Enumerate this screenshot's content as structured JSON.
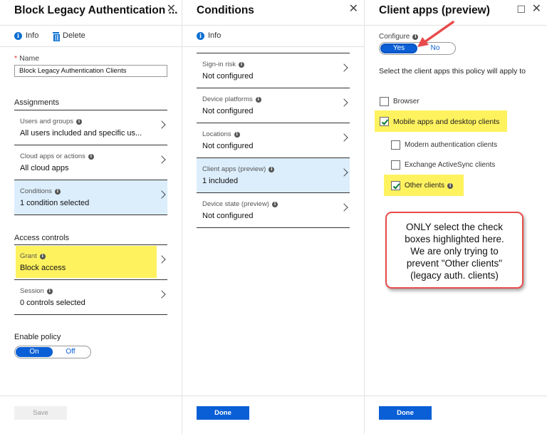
{
  "policy_blade": {
    "title": "Block Legacy Authentication ...",
    "close_icon": "close-icon",
    "toolbar": [
      {
        "label": "Info",
        "icon": "info-icon"
      },
      {
        "label": "Delete",
        "icon": "trash-icon"
      }
    ],
    "name_label": "Name",
    "name_required": "*",
    "name_value": "Block Legacy Authentication Clients",
    "assignments_title": "Assignments",
    "assignments": [
      {
        "label": "Users and groups",
        "value": "All users included and specific us..."
      },
      {
        "label": "Cloud apps or actions",
        "value": "All cloud apps"
      },
      {
        "label": "Conditions",
        "value": "1 condition selected",
        "selected": true
      }
    ],
    "access_controls_title": "Access controls",
    "access_controls": [
      {
        "label": "Grant",
        "value": "Block access",
        "highlighted": true
      },
      {
        "label": "Session",
        "value": "0 controls selected"
      }
    ],
    "enable_policy_label": "Enable policy",
    "enable_toggle": {
      "on": "On",
      "off": "Off",
      "selected": "On"
    },
    "save_label": "Save"
  },
  "conditions_blade": {
    "title": "Conditions",
    "toolbar": [
      {
        "label": "Info",
        "icon": "info-icon"
      }
    ],
    "items": [
      {
        "label": "Sign-in risk",
        "value": "Not configured"
      },
      {
        "label": "Device platforms",
        "value": "Not configured"
      },
      {
        "label": "Locations",
        "value": "Not configured"
      },
      {
        "label": "Client apps (preview)",
        "value": "1 included",
        "selected": true
      },
      {
        "label": "Device state (preview)",
        "value": "Not configured"
      }
    ],
    "done_label": "Done"
  },
  "client_apps_blade": {
    "title": "Client apps (preview)",
    "configure_label": "Configure",
    "configure_toggle": {
      "on": "Yes",
      "off": "No",
      "selected": "Yes"
    },
    "description": "Select the client apps this policy will apply to",
    "checkboxes": [
      {
        "label": "Browser",
        "checked": false
      },
      {
        "label": "Mobile apps and desktop clients",
        "checked": true,
        "highlighted": true
      },
      {
        "label": "Modern authentication clients",
        "checked": false
      },
      {
        "label": "Exchange ActiveSync clients",
        "checked": false
      },
      {
        "label": "Other clients",
        "checked": true,
        "highlighted": true
      }
    ],
    "done_label": "Done"
  },
  "annotation": {
    "callout_text": "ONLY select the check\nboxes highlighted here.\nWe are only trying to\nprevent \"Other clients\"\n(legacy auth. clients)",
    "arrow_color": "#e84a4a",
    "highlight_color": "#fff25f"
  }
}
